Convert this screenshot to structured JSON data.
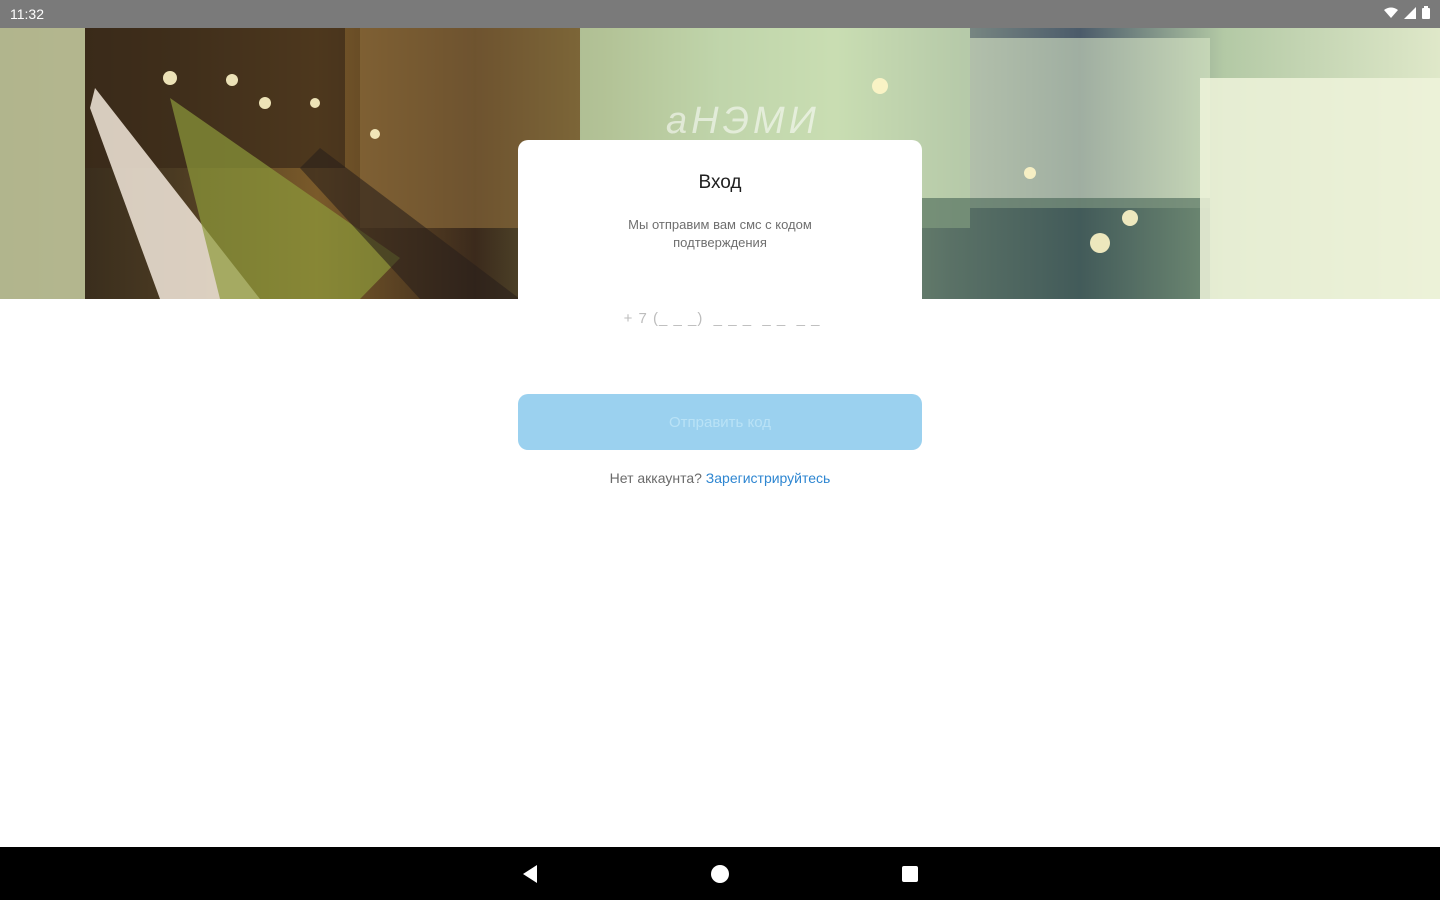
{
  "status_bar": {
    "time": "11:32"
  },
  "hero": {
    "logo_text": "аНЭМИ"
  },
  "login": {
    "title": "Вход",
    "subtitle": "Мы отправим вам смс с кодом подтверждения",
    "phone_placeholder": "+ 7 (_ _ _)  _ _ _  _ _  _ _",
    "send_button": "Отправить код",
    "no_account_text": "Нет аккаунта?",
    "register_link": "Зарегистрируйтесь"
  },
  "colors": {
    "button_bg": "#9bd1ef",
    "link": "#2e86d1"
  },
  "icons": {
    "status": [
      "wifi-icon",
      "signal-icon",
      "battery-icon"
    ],
    "nav": [
      "back-icon",
      "home-icon",
      "recents-icon"
    ]
  }
}
